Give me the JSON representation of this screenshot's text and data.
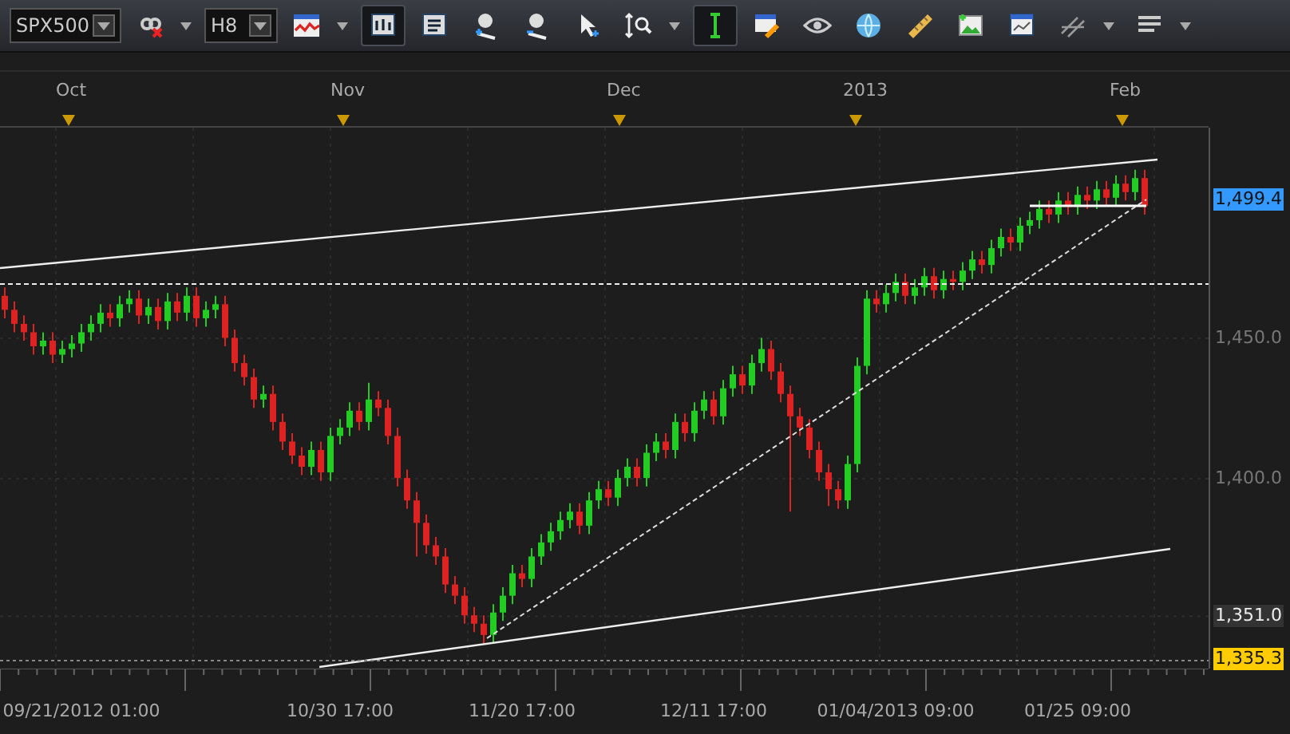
{
  "toolbar": {
    "symbol": "SPX500",
    "timeframe": "H8",
    "buttons": [
      {
        "kind": "link",
        "selected": false,
        "has_menu": true
      },
      {
        "kind": "chart-type",
        "selected": false,
        "has_menu": true
      },
      {
        "kind": "bars-view",
        "selected": true,
        "has_menu": false
      },
      {
        "kind": "text-view",
        "selected": false,
        "has_menu": false
      },
      {
        "kind": "zoom-in",
        "selected": false,
        "has_menu": false
      },
      {
        "kind": "zoom-out",
        "selected": false,
        "has_menu": false
      },
      {
        "kind": "cursor",
        "selected": false,
        "has_menu": false
      },
      {
        "kind": "zoom-range",
        "selected": false,
        "has_menu": true
      },
      {
        "kind": "crosshair",
        "selected": true,
        "has_menu": false
      },
      {
        "kind": "edit",
        "selected": false,
        "has_menu": false
      },
      {
        "kind": "eye",
        "selected": false,
        "has_menu": false
      },
      {
        "kind": "globe",
        "selected": false,
        "has_menu": false
      },
      {
        "kind": "ruler",
        "selected": false,
        "has_menu": false
      },
      {
        "kind": "image",
        "selected": false,
        "has_menu": false
      },
      {
        "kind": "window",
        "selected": false,
        "has_menu": false
      },
      {
        "kind": "lines",
        "selected": false,
        "has_menu": true
      },
      {
        "kind": "list",
        "selected": false,
        "has_menu": true
      }
    ]
  },
  "top_axis": {
    "labels": [
      "Oct",
      "Nov",
      "Dec",
      "2013",
      "Feb"
    ]
  },
  "price_axis": {
    "tick_styles": [
      {
        "highlighted": true,
        "color": "#3399ff"
      },
      {
        "highlighted": false
      },
      {
        "highlighted": false
      },
      {
        "highlighted": true,
        "color": "#333333"
      },
      {
        "highlighted": true,
        "color": "#ffcc00"
      }
    ]
  },
  "chart": {
    "chart_data": {
      "type": "candlestick",
      "ylim": [
        1332,
        1525
      ],
      "grid": true,
      "yticks": [
        {
          "value": 1499.4,
          "label": "1,499.4"
        },
        {
          "value": 1450,
          "label": "1,450.0"
        },
        {
          "value": 1400,
          "label": "1,400.0"
        },
        {
          "value": 1351,
          "label": "1,351.0"
        },
        {
          "value": 1335.3,
          "label": "1,335.3"
        }
      ],
      "categories": [
        null,
        null,
        null,
        null,
        null,
        null,
        null,
        null,
        "09/21/2012 01:00",
        null,
        null,
        null,
        null,
        null,
        null,
        null,
        null,
        null,
        null,
        null,
        null,
        null,
        null,
        null,
        null,
        null,
        null,
        null,
        null,
        null,
        null,
        null,
        null,
        null,
        null,
        "10/30 17:00",
        null,
        null,
        null,
        null,
        null,
        null,
        null,
        null,
        null,
        null,
        null,
        null,
        null,
        null,
        null,
        null,
        null,
        null,
        "11/20 17:00",
        null,
        null,
        null,
        null,
        null,
        null,
        null,
        null,
        null,
        null,
        null,
        null,
        null,
        null,
        null,
        null,
        null,
        null,
        null,
        "12/11 17:00",
        null,
        null,
        null,
        null,
        null,
        null,
        null,
        null,
        null,
        null,
        null,
        null,
        null,
        null,
        null,
        null,
        null,
        null,
        "01/04/2013 09:00",
        null,
        null,
        null,
        null,
        null,
        null,
        null,
        null,
        null,
        null,
        null,
        null,
        null,
        null,
        null,
        null,
        null,
        null,
        "01/25 09:00",
        null,
        null,
        null,
        null,
        null,
        null,
        null
      ],
      "ohlc": [
        [
          1465,
          1468,
          1457,
          1460
        ],
        [
          1460,
          1463,
          1452,
          1455
        ],
        [
          1455,
          1458,
          1449,
          1452
        ],
        [
          1452,
          1455,
          1444,
          1447
        ],
        [
          1447,
          1452,
          1444,
          1449
        ],
        [
          1449,
          1452,
          1441,
          1444
        ],
        [
          1444,
          1449,
          1441,
          1446
        ],
        [
          1446,
          1451,
          1443,
          1448
        ],
        [
          1448,
          1455,
          1445,
          1452
        ],
        [
          1452,
          1458,
          1449,
          1455
        ],
        [
          1455,
          1462,
          1452,
          1459
        ],
        [
          1459,
          1462,
          1454,
          1457
        ],
        [
          1457,
          1465,
          1454,
          1462
        ],
        [
          1462,
          1467,
          1459,
          1464
        ],
        [
          1464,
          1467,
          1455,
          1458
        ],
        [
          1458,
          1464,
          1455,
          1461
        ],
        [
          1461,
          1464,
          1453,
          1456
        ],
        [
          1456,
          1466,
          1453,
          1463
        ],
        [
          1463,
          1466,
          1456,
          1459
        ],
        [
          1459,
          1468,
          1456,
          1465
        ],
        [
          1465,
          1468,
          1454,
          1457
        ],
        [
          1457,
          1463,
          1454,
          1460
        ],
        [
          1460,
          1465,
          1457,
          1462
        ],
        [
          1462,
          1465,
          1447,
          1450
        ],
        [
          1450,
          1453,
          1438,
          1441
        ],
        [
          1441,
          1444,
          1433,
          1436
        ],
        [
          1436,
          1439,
          1425,
          1428
        ],
        [
          1428,
          1433,
          1425,
          1430
        ],
        [
          1430,
          1433,
          1417,
          1420
        ],
        [
          1420,
          1423,
          1410,
          1413
        ],
        [
          1413,
          1416,
          1405,
          1408
        ],
        [
          1408,
          1411,
          1401,
          1404
        ],
        [
          1404,
          1413,
          1401,
          1410
        ],
        [
          1410,
          1413,
          1399,
          1402
        ],
        [
          1402,
          1418,
          1399,
          1415
        ],
        [
          1415,
          1421,
          1412,
          1418
        ],
        [
          1418,
          1427,
          1415,
          1424
        ],
        [
          1424,
          1427,
          1417,
          1420
        ],
        [
          1420,
          1434,
          1417,
          1428
        ],
        [
          1428,
          1431,
          1422,
          1425
        ],
        [
          1425,
          1428,
          1412,
          1415
        ],
        [
          1415,
          1418,
          1397,
          1400
        ],
        [
          1400,
          1403,
          1389,
          1392
        ],
        [
          1392,
          1395,
          1372,
          1384
        ],
        [
          1384,
          1387,
          1373,
          1376
        ],
        [
          1376,
          1379,
          1369,
          1372
        ],
        [
          1372,
          1375,
          1359,
          1362
        ],
        [
          1362,
          1365,
          1355,
          1358
        ],
        [
          1358,
          1361,
          1348,
          1351
        ],
        [
          1351,
          1354,
          1345,
          1348
        ],
        [
          1348,
          1351,
          1341,
          1344
        ],
        [
          1344,
          1355,
          1341,
          1352
        ],
        [
          1352,
          1361,
          1349,
          1358
        ],
        [
          1358,
          1369,
          1355,
          1366
        ],
        [
          1366,
          1369,
          1361,
          1364
        ],
        [
          1364,
          1375,
          1361,
          1372
        ],
        [
          1372,
          1380,
          1369,
          1377
        ],
        [
          1377,
          1384,
          1374,
          1381
        ],
        [
          1381,
          1388,
          1378,
          1385
        ],
        [
          1385,
          1391,
          1382,
          1388
        ],
        [
          1388,
          1391,
          1380,
          1383
        ],
        [
          1383,
          1395,
          1380,
          1392
        ],
        [
          1392,
          1399,
          1389,
          1396
        ],
        [
          1396,
          1399,
          1390,
          1393
        ],
        [
          1393,
          1403,
          1390,
          1400
        ],
        [
          1400,
          1407,
          1397,
          1404
        ],
        [
          1404,
          1407,
          1397,
          1400
        ],
        [
          1400,
          1412,
          1397,
          1409
        ],
        [
          1409,
          1416,
          1406,
          1413
        ],
        [
          1413,
          1416,
          1407,
          1410
        ],
        [
          1410,
          1423,
          1407,
          1420
        ],
        [
          1420,
          1423,
          1413,
          1416
        ],
        [
          1416,
          1427,
          1413,
          1424
        ],
        [
          1424,
          1431,
          1421,
          1428
        ],
        [
          1428,
          1431,
          1419,
          1422
        ],
        [
          1422,
          1435,
          1419,
          1432
        ],
        [
          1432,
          1440,
          1429,
          1437
        ],
        [
          1437,
          1440,
          1430,
          1433
        ],
        [
          1433,
          1444,
          1430,
          1441
        ],
        [
          1441,
          1450,
          1438,
          1446
        ],
        [
          1446,
          1449,
          1435,
          1438
        ],
        [
          1438,
          1441,
          1427,
          1430
        ],
        [
          1430,
          1433,
          1388,
          1422
        ],
        [
          1422,
          1425,
          1415,
          1418
        ],
        [
          1418,
          1421,
          1407,
          1410
        ],
        [
          1410,
          1413,
          1399,
          1402
        ],
        [
          1402,
          1405,
          1390,
          1396
        ],
        [
          1396,
          1399,
          1389,
          1392
        ],
        [
          1392,
          1408,
          1389,
          1405
        ],
        [
          1405,
          1443,
          1402,
          1440
        ],
        [
          1440,
          1467,
          1437,
          1464
        ],
        [
          1464,
          1467,
          1459,
          1462
        ],
        [
          1462,
          1469,
          1459,
          1466
        ],
        [
          1466,
          1473,
          1463,
          1470
        ],
        [
          1470,
          1473,
          1462,
          1465
        ],
        [
          1465,
          1471,
          1462,
          1468
        ],
        [
          1468,
          1475,
          1465,
          1472
        ],
        [
          1472,
          1475,
          1464,
          1467
        ],
        [
          1467,
          1474,
          1464,
          1471
        ],
        [
          1471,
          1474,
          1467,
          1470
        ],
        [
          1470,
          1477,
          1467,
          1474
        ],
        [
          1474,
          1481,
          1471,
          1478
        ],
        [
          1478,
          1481,
          1473,
          1476
        ],
        [
          1476,
          1485,
          1473,
          1482
        ],
        [
          1482,
          1489,
          1479,
          1486
        ],
        [
          1486,
          1489,
          1481,
          1484
        ],
        [
          1484,
          1493,
          1481,
          1490
        ],
        [
          1490,
          1495,
          1487,
          1492
        ],
        [
          1492,
          1499,
          1489,
          1496
        ],
        [
          1496,
          1499,
          1491,
          1494
        ],
        [
          1494,
          1502,
          1491,
          1499
        ],
        [
          1499,
          1502,
          1494,
          1497
        ],
        [
          1497,
          1504,
          1494,
          1501
        ],
        [
          1501,
          1504,
          1496,
          1499
        ],
        [
          1499,
          1506,
          1496,
          1503
        ],
        [
          1503,
          1506,
          1497,
          1500
        ],
        [
          1500,
          1508,
          1497,
          1505
        ],
        [
          1505,
          1508,
          1499,
          1502
        ],
        [
          1502,
          1510,
          1499,
          1507
        ],
        [
          1507,
          1510,
          1494,
          1497
        ]
      ]
    }
  }
}
